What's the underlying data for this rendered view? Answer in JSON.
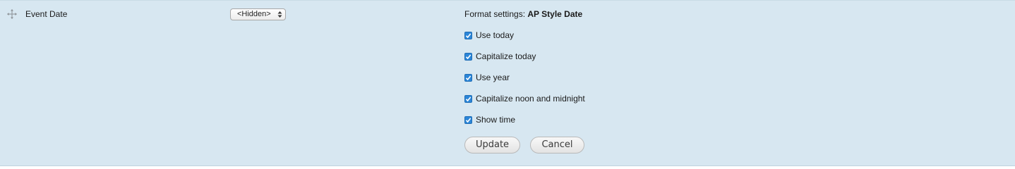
{
  "field": {
    "label": "Event Date",
    "drag_icon": "move-arrows-icon"
  },
  "label_select": {
    "selected": "<Hidden>",
    "arrow_icon": "updown-arrows-icon"
  },
  "format": {
    "prefix": "Format settings:",
    "name": "AP Style Date",
    "options": [
      {
        "label": "Use today",
        "checked": true
      },
      {
        "label": "Capitalize today",
        "checked": true
      },
      {
        "label": "Use year",
        "checked": true
      },
      {
        "label": "Capitalize noon and midnight",
        "checked": true
      },
      {
        "label": "Show time",
        "checked": true
      }
    ]
  },
  "buttons": {
    "update_label": "Update",
    "cancel_label": "Cancel"
  },
  "colors": {
    "row_background": "#d7e7f1",
    "checkbox_blue": "#2b86d8"
  }
}
